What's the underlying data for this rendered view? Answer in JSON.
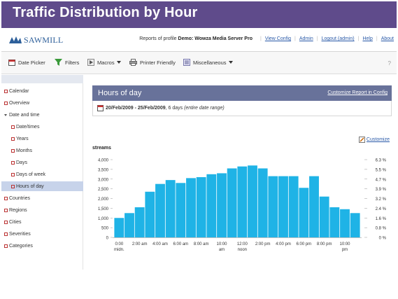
{
  "slide_title": "Traffic Distribution by Hour",
  "app": {
    "logo_text": "SAWMILL",
    "profile_prefix": "Reports of profile",
    "profile_name": "Demo: Wowza Media Server Pro",
    "links": [
      "View Config",
      "Admin",
      "Logout (admin)",
      "Help",
      "About"
    ]
  },
  "toolbar": {
    "date_picker": "Date Picker",
    "filters": "Filters",
    "macros": "Macros",
    "printer_friendly": "Printer Friendly",
    "miscellaneous": "Miscellaneous",
    "help": "?"
  },
  "sidebar": {
    "items": [
      {
        "label": "Calendar"
      },
      {
        "label": "Overview"
      },
      {
        "label": "Date and time"
      },
      {
        "label": "Date/times"
      },
      {
        "label": "Years"
      },
      {
        "label": "Months"
      },
      {
        "label": "Days"
      },
      {
        "label": "Days of week"
      },
      {
        "label": "Hours of day"
      },
      {
        "label": "Countries"
      },
      {
        "label": "Regions"
      },
      {
        "label": "Cities"
      },
      {
        "label": "Severities"
      },
      {
        "label": "Categories"
      }
    ]
  },
  "report": {
    "title": "Hours of day",
    "customize_in_config": "Customize Report in Config",
    "date_range_bold": "20/Feb/2009 - 25/Feb/2009",
    "date_range_days": ", 6 days ",
    "date_range_note": "(entire date range)",
    "customize": "Customize"
  },
  "chart_data": {
    "type": "bar",
    "ylabel": "streams",
    "ylim": [
      0,
      4000
    ],
    "y_ticks": [
      "0",
      "500",
      "1,000",
      "1,500",
      "2,000",
      "2,500",
      "3,000",
      "3,500",
      "4,000"
    ],
    "right_ticks": [
      "0 %",
      "0.8 %",
      "1.6 %",
      "2.4 %",
      "3.2 %",
      "3.9 %",
      "4.7 %",
      "5.5 %",
      "6.3 %"
    ],
    "x_tick_labels": [
      {
        "line1": "0:00",
        "line2": "midn."
      },
      {
        "line1": "2:00 am",
        "line2": ""
      },
      {
        "line1": "4:00 am",
        "line2": ""
      },
      {
        "line1": "6:00 am",
        "line2": ""
      },
      {
        "line1": "8:00 am",
        "line2": ""
      },
      {
        "line1": "10:00",
        "line2": "am"
      },
      {
        "line1": "12:00",
        "line2": "noon"
      },
      {
        "line1": "2:00 pm",
        "line2": ""
      },
      {
        "line1": "4:00 pm",
        "line2": ""
      },
      {
        "line1": "6:00 pm",
        "line2": ""
      },
      {
        "line1": "8:00 pm",
        "line2": ""
      },
      {
        "line1": "10:00",
        "line2": "pm"
      }
    ],
    "values": [
      1000,
      1250,
      1550,
      2350,
      2750,
      2950,
      2800,
      3050,
      3100,
      3250,
      3300,
      3550,
      3650,
      3700,
      3550,
      3150,
      3150,
      3150,
      2550,
      3150,
      2100,
      1550,
      1450,
      1250
    ],
    "bar_color": "#1fb3e6"
  }
}
